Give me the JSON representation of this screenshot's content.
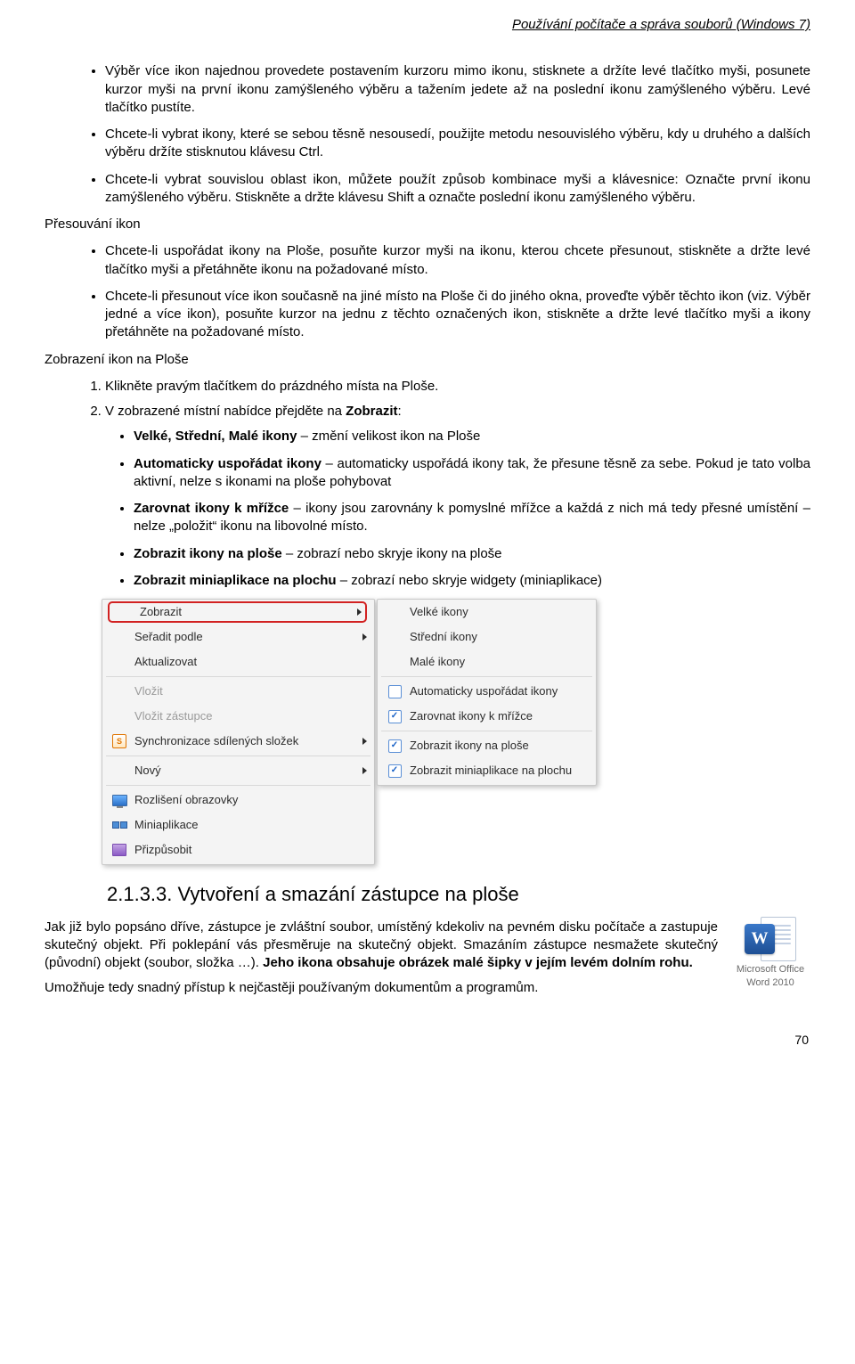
{
  "header": "Používání počítače a správa souborů (Windows 7)",
  "bullets_top": [
    "Výběr více ikon najednou provedete postavením kurzoru mimo ikonu, stisknete a držíte levé tlačítko myši, posunete kurzor myši na první ikonu zamýšleného výběru a tažením jedete až na poslední ikonu zamýšleného výběru. Levé tlačítko pustíte.",
    "Chcete-li vybrat ikony, které se sebou těsně nesousedí, použijte metodu nesouvislého výběru, kdy u druhého a dalších výběru držíte stisknutou klávesu Ctrl.",
    "Chcete-li vybrat souvislou oblast ikon, můžete použít způsob kombinace myši a klávesnice: Označte první ikonu zamýšleného výběru. Stiskněte a držte klávesu Shift a označte poslední ikonu zamýšleného výběru."
  ],
  "sub1_title": "Přesouvání ikon",
  "sub1_bullets": [
    "Chcete-li uspořádat ikony na Ploše, posuňte kurzor myši na ikonu, kterou chcete přesunout, stiskněte a držte levé tlačítko myši a přetáhněte ikonu na požadované místo.",
    "Chcete-li přesunout více ikon současně na jiné místo na Ploše či do jiného okna, proveďte výběr těchto ikon (viz. Výběr jedné a více ikon), posuňte kurzor na jednu z těchto označených ikon, stiskněte a držte levé tlačítko myši a ikony přetáhněte na požadované místo."
  ],
  "sub2_title": "Zobrazení ikon na Ploše",
  "sub2_ol": [
    "Klikněte pravým tlačítkem do prázdného místa na Ploše.",
    {
      "pre": "V zobrazené místní nabídce přejděte na ",
      "bold": "Zobrazit",
      "post": ":"
    }
  ],
  "zobrazit_items": [
    {
      "b": "Velké, Střední, Malé ikony",
      "rest": " – změní velikost ikon na Ploše"
    },
    {
      "b": "Automaticky uspořádat ikony",
      "rest": " – automaticky uspořádá ikony tak, že přesune těsně za sebe. Pokud je tato volba aktivní, nelze s ikonami na ploše pohybovat"
    },
    {
      "b": "Zarovnat ikony k mřížce",
      "rest": " – ikony jsou zarovnány k pomyslné mřížce a každá z nich má tedy přesné umístění – nelze „položit“ ikonu na libovolné místo."
    },
    {
      "b": "Zobrazit ikony na ploše",
      "rest": " – zobrazí nebo skryje ikony na ploše"
    },
    {
      "b": "Zobrazit miniaplikace na plochu",
      "rest": " – zobrazí nebo skryje widgety (miniaplikace)"
    }
  ],
  "menu_left": {
    "zobrazit": "Zobrazit",
    "seradit": "Seřadit podle",
    "aktualizovat": "Aktualizovat",
    "vlozit": "Vložit",
    "vlozit_zastupce": "Vložit zástupce",
    "sync": "Synchronizace sdílených složek",
    "novy": "Nový",
    "rozliseni": "Rozlišení obrazovky",
    "miniaplikace": "Miniaplikace",
    "prizpusobit": "Přizpůsobit"
  },
  "menu_right": {
    "velke": "Velké ikony",
    "stredni": "Střední ikony",
    "male": "Malé ikony",
    "auto": "Automaticky uspořádat ikony",
    "zarovnat": "Zarovnat ikony k mřížce",
    "zobrazit_ikony": "Zobrazit ikony na ploše",
    "zobrazit_mini": "Zobrazit miniaplikace na plochu"
  },
  "checks": {
    "auto": false,
    "zarovnat": true,
    "ikony": true,
    "mini": true
  },
  "section_heading": "2.1.3.3. Vytvoření a smazání zástupce na ploše",
  "para1a": "Jak již bylo popsáno dříve, zástupce je zvláštní soubor, umístěný kdekoliv na pevném disku počítače a zastupuje skutečný objekt. Při poklepání vás přesměruje na skutečný objekt. Smazáním zástupce nesmažete skutečný (původní) objekt (soubor, složka …). ",
  "para1b_bold": "Jeho ikona obsahuje obrázek malé šipky v jejím levém dolním rohu.",
  "para2": "Umožňuje tedy snadný přístup k nejčastěji používaným dokumentům a programům.",
  "word_label1": "Microsoft Office",
  "word_label2": "Word 2010",
  "page_number": "70",
  "check_glyph": "✓",
  "s_glyph": "S"
}
